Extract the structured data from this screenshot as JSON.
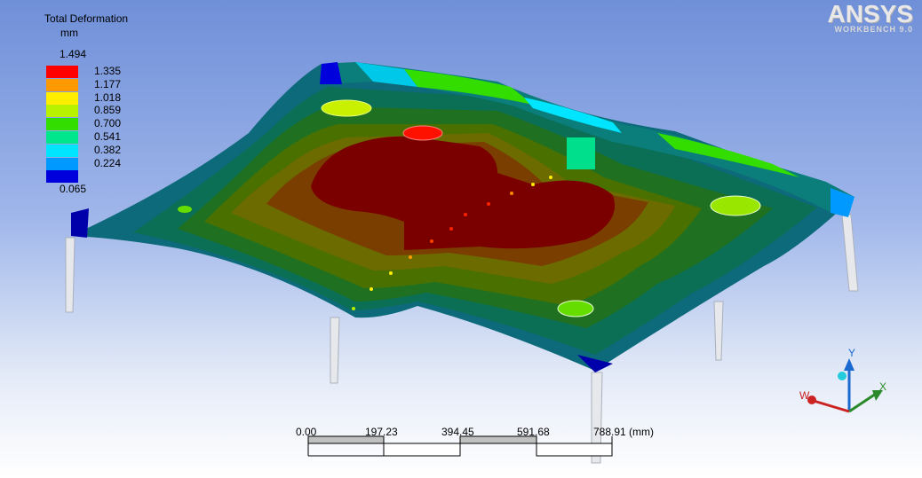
{
  "legend": {
    "title": "Total Deformation",
    "unit": "mm",
    "max_value": "1.494",
    "min_value": "0.065",
    "bands": [
      {
        "label": "1.335",
        "color": "#ff0000"
      },
      {
        "label": "1.177",
        "color": "#ff9900"
      },
      {
        "label": "1.018",
        "color": "#ffee00"
      },
      {
        "label": "0.859",
        "color": "#b8f200"
      },
      {
        "label": "0.700",
        "color": "#33dd00"
      },
      {
        "label": "0.541",
        "color": "#00e68c"
      },
      {
        "label": "0.382",
        "color": "#00e5ff"
      },
      {
        "label": "0.224",
        "color": "#0099ff"
      },
      {
        "label": "",
        "color": "#0000dd"
      }
    ]
  },
  "logo": {
    "brand": "ANSYS",
    "sub": "WORKBENCH 9.0"
  },
  "scale": {
    "labels": [
      "0.00",
      "197.23",
      "394.45",
      "591.68",
      "788.91 (mm)"
    ]
  },
  "triad": {
    "y": "Y",
    "x": "X",
    "w": "W"
  },
  "colors": {
    "max_contour": "#7a0000",
    "contour_2": "#7a3e00",
    "contour_3": "#6b6b00",
    "contour_4": "#4a7000",
    "contour_5": "#1f7020",
    "contour_6": "#0b6f55",
    "contour_7": "#0c6a7a"
  }
}
